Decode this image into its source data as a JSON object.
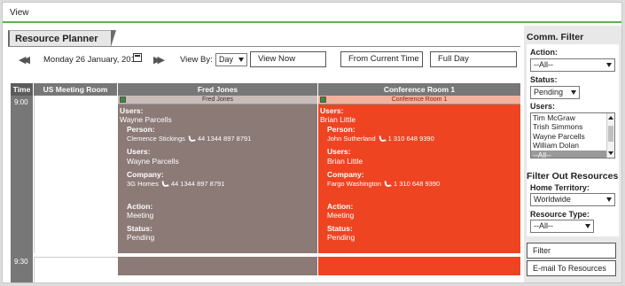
{
  "topbar": {
    "view_tab": "View"
  },
  "planner": {
    "tab_label": "Resource Planner",
    "date": "Monday 26 January, 2019",
    "view_by_label": "View By:",
    "view_by_value": "Day",
    "buttons": {
      "view_now": "View Now",
      "from_current_time": "From Current Time",
      "full_day": "Full Day"
    }
  },
  "grid": {
    "headers": {
      "time": "Time",
      "us_meeting_room": "US Meeting Room",
      "fred_jones": "Fred Jones",
      "conference_room": "Conference Room 1"
    },
    "times": [
      "9:00",
      "9:30"
    ],
    "appointments": [
      {
        "strip_name": "Fred Jones",
        "users_label": "Users:",
        "users_value": "Wayne Parcells",
        "person_label": "Person:",
        "person_name": "Clemence Stickings",
        "person_phone": "44 1344 897 8791",
        "users2_label": "Users:",
        "users2_value": "Wayne Parcells",
        "company_label": "Company:",
        "company_name": "3G Homes",
        "company_phone": "44 1344 897 8791",
        "action_label": "Action:",
        "action_value": "Meeting",
        "status_label": "Status:",
        "status_value": "Pending"
      },
      {
        "strip_name": "Conference Room 1",
        "users_label": "Users:",
        "users_value": "Brian Little",
        "person_label": "Person:",
        "person_name": "John Sutherland",
        "person_phone": "1 310 648 9390",
        "users2_label": "Users:",
        "users2_value": "Brian Little",
        "company_label": "Company:",
        "company_name": "Fargo Washington",
        "company_phone": "1 310 648 9390",
        "action_label": "Action:",
        "action_value": "Meeting",
        "status_label": "Status:",
        "status_value": "Pending"
      }
    ]
  },
  "comm_filter": {
    "title": "Comm. Filter",
    "action_label": "Action:",
    "action_value": "--All--",
    "status_label": "Status:",
    "status_value": "Pending",
    "users_label": "Users:",
    "users_list": [
      "Tim McGraw",
      "Trish Simmons",
      "Wayne Parcells",
      "William Dolan",
      "--All--"
    ]
  },
  "filter_out": {
    "title": "Filter Out Resources",
    "territory_label": "Home Territory:",
    "territory_value": "Worldwide",
    "resource_type_label": "Resource Type:",
    "resource_type_value": "--All--",
    "filter_button": "Filter",
    "email_button": "E-mail To Resources"
  },
  "colors": {
    "accent_green": "#5bb44a",
    "appt_brown": "#8c7a77",
    "appt_red": "#ee4422",
    "header_grey": "#777777"
  }
}
